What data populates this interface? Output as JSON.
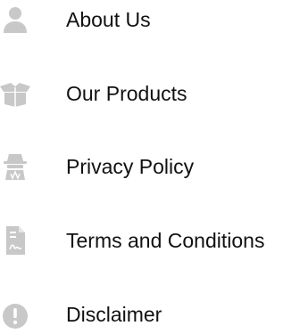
{
  "menu": {
    "icon_color": "#c8c8c8",
    "items": [
      {
        "label": "About Us",
        "icon": "user-icon"
      },
      {
        "label": "Our Products",
        "icon": "box-icon"
      },
      {
        "label": "Privacy Policy",
        "icon": "spy-icon"
      },
      {
        "label": "Terms and Conditions",
        "icon": "document-signature-icon"
      },
      {
        "label": "Disclaimer",
        "icon": "exclamation-circle-icon"
      }
    ]
  }
}
